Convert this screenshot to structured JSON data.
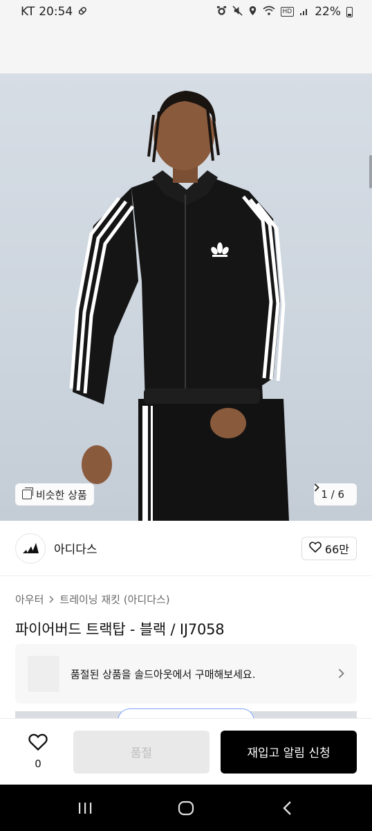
{
  "status_bar": {
    "carrier": "KT",
    "time": "20:54",
    "battery": "22%",
    "icons": [
      "pill-icon",
      "alarm-icon",
      "mute-icon",
      "location-icon",
      "wifi-icon",
      "hd-icon",
      "signal-icon",
      "battery-icon"
    ]
  },
  "hero": {
    "similar_label": "비슷한 상품",
    "page_indicator": "1 / 6",
    "colors": {
      "background": "#cdd5de",
      "jacket": "#141414",
      "stripe": "#ffffff",
      "skin": "#8a5a3c"
    }
  },
  "brand": {
    "name": "아디다스",
    "likes": "66만"
  },
  "breadcrumb": {
    "items": [
      "아우터",
      "트레이닝 재킷 (아디다스)"
    ]
  },
  "product": {
    "title": "파이어버드 트랙탑 - 블랙 / IJ7058"
  },
  "soldout_banner": {
    "text": "품절된 상품을 솔드아웃에서 구매해보세요."
  },
  "bottom_bar": {
    "wish_count": "0",
    "soldout_label": "품절",
    "restock_label": "재입고 알림 신청"
  },
  "nav": {
    "icons": [
      "recent-apps-icon",
      "home-icon",
      "back-icon"
    ]
  }
}
